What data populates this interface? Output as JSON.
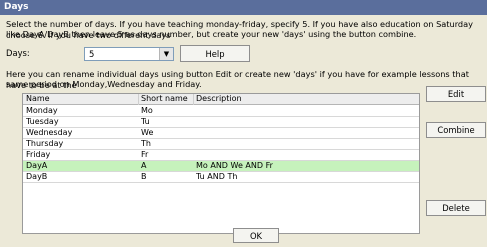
{
  "window": {
    "title": "Days"
  },
  "intro": {
    "line1": "Select the number of days. If you have teaching monday-friday, specify 5. If you have also education on Saturday choose 6. If you have two different days",
    "line2": "like DayA/DayB then leave 5 as days number, but create your new 'days' using the button combine."
  },
  "days_field": {
    "label": "Days:",
    "value": "5"
  },
  "buttons": {
    "help": "Help",
    "edit": "Edit",
    "combine": "Combine",
    "delete": "Delete",
    "ok": "OK"
  },
  "rename_text": {
    "line1": "Here you can rename individual days using button Edit or create new 'days' if you have for example lessons that have to be at the",
    "line2": "same period on Monday,Wednesday and Friday."
  },
  "table": {
    "headers": [
      "Name",
      "Short name",
      "Description"
    ],
    "rows": [
      [
        "Monday",
        "Mo",
        ""
      ],
      [
        "Tuesday",
        "Tu",
        ""
      ],
      [
        "Wednesday",
        "We",
        ""
      ],
      [
        "Thursday",
        "Th",
        ""
      ],
      [
        "Friday",
        "Fr",
        ""
      ],
      [
        "DayA",
        "A",
        "Mo AND We AND Fr"
      ],
      [
        "DayB",
        "B",
        "Tu AND Th"
      ]
    ],
    "selected_row": 5
  }
}
